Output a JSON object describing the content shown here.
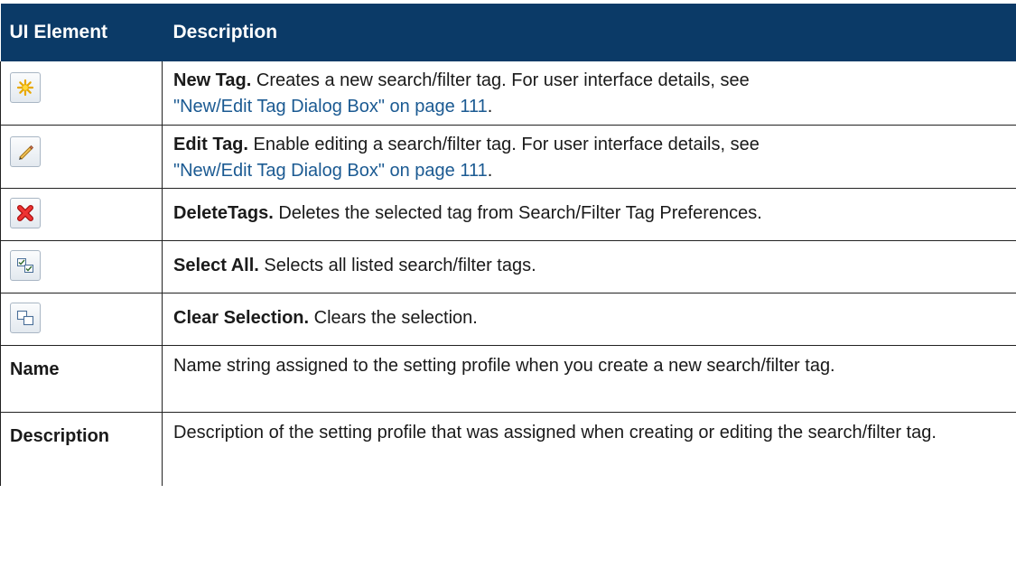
{
  "header": {
    "col1": "UI Element",
    "col2": "Description"
  },
  "rows": [
    {
      "element_icon": "new-tag-icon",
      "term": "New Tag.",
      "text": "Creates a new search/filter tag. For user interface details, see",
      "link": "\"New/Edit Tag Dialog Box\" on page 111",
      "after_link": "."
    },
    {
      "element_icon": "edit-tag-icon",
      "term": "Edit Tag.",
      "text": "Enable editing a search/filter tag. For user interface details, see",
      "link": "\"New/Edit Tag Dialog Box\" on page 111",
      "after_link": "."
    },
    {
      "element_icon": "delete-tags-icon",
      "term": "DeleteTags.",
      "text": "Deletes the selected tag from Search/Filter Tag Preferences."
    },
    {
      "element_icon": "select-all-icon",
      "term": "Select All.",
      "text": "Selects all listed search/filter tags."
    },
    {
      "element_icon": "clear-selection-icon",
      "term": "Clear Selection.",
      "text": "Clears the selection."
    },
    {
      "element_label": "Name",
      "text": "Name string assigned to the setting profile when you create a new search/filter tag."
    },
    {
      "element_label": "Description",
      "text": "Description of the setting profile that was assigned when creating or editing the search/filter tag."
    }
  ],
  "colors": {
    "header_bg": "#0b3a67",
    "header_text": "#ffffff",
    "link": "#1b5a92"
  }
}
